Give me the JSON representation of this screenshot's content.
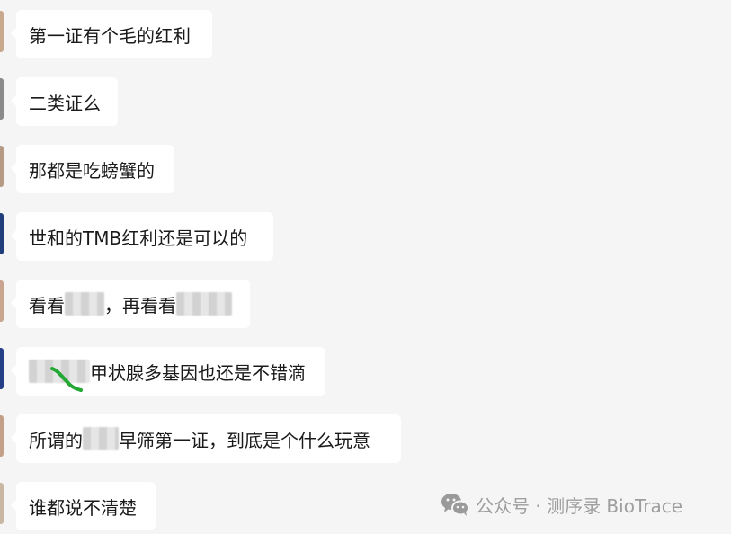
{
  "messages": [
    {
      "id": "m1",
      "text": "第一证有个毛的红利",
      "avatar_color": "#c8a98c"
    },
    {
      "id": "m2",
      "text": "二类证么",
      "avatar_color": "#8a8a8a"
    },
    {
      "id": "m3",
      "text": "那都是吃螃蟹的",
      "avatar_color": "#b59a84"
    },
    {
      "id": "m4",
      "text": "世和的TMB红利还是可以的",
      "avatar_color": "#1f3e7a"
    },
    {
      "id": "m5",
      "text_a": "看看",
      "text_b": "，再看看",
      "avatar_color": "#c9a58f"
    },
    {
      "id": "m6",
      "text": "甲状腺多基因也还是不错滴",
      "avatar_color": "#243f86"
    },
    {
      "id": "m7",
      "text_a": "所谓的",
      "text_b": "早筛第一证，到底是个什么玩意",
      "avatar_color": "#c2a08a"
    },
    {
      "id": "m8",
      "text": "谁都说不清楚",
      "avatar_color": "#c9b7a3"
    }
  ],
  "watermark": {
    "text": "公众号 · 测序录 BioTrace",
    "icon": "wechat-icon"
  },
  "colors": {
    "background": "#f5f5f5",
    "bubble": "#ffffff",
    "text": "#1a1a1a",
    "watermark": "#9a9a9a",
    "scribble": "#22a833"
  }
}
